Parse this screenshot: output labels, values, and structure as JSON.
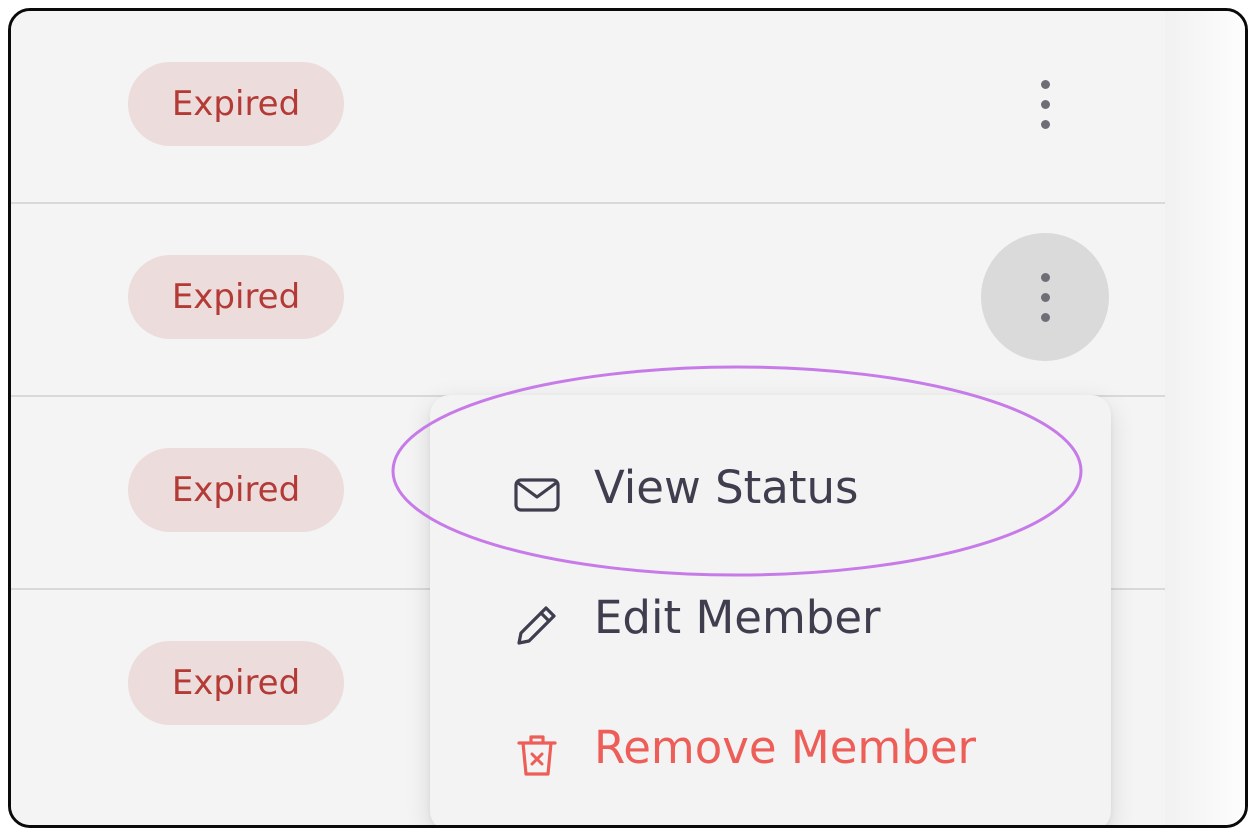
{
  "rows": [
    {
      "status": "Expired"
    },
    {
      "status": "Expired"
    },
    {
      "status": "Expired"
    },
    {
      "status": "Expired"
    }
  ],
  "row_menu": {
    "items": [
      {
        "label": "View Status",
        "icon": "envelope-icon"
      },
      {
        "label": "Edit Member",
        "icon": "pencil-icon"
      },
      {
        "label": "Remove Member",
        "icon": "trash-icon",
        "danger": true
      }
    ]
  },
  "colors": {
    "status_badge_bg": "#ecdcdc",
    "status_badge_text": "#b43a36",
    "danger_text": "#ee5e58",
    "highlight_outline": "#c77be8"
  }
}
